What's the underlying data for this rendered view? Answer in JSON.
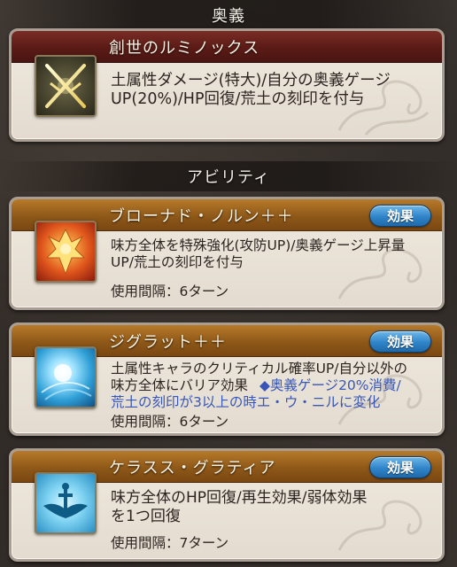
{
  "sections": {
    "ougi_label": "奥義",
    "ability_label": "アビリティ"
  },
  "ougi": {
    "name": "創世のルミノックス",
    "description_line1": "土属性ダメージ(特大)/自分の奥義ゲージ",
    "description_line2": "UP(20%)/HP回復/荒土の刻印を付与",
    "icon": "crossed-swords-icon"
  },
  "abilities": [
    {
      "name": "ブローナド・ノルン＋＋",
      "button_label": "効果",
      "description_line1": "味方全体を特殊強化(攻防UP)/奥義ゲージ上昇量",
      "description_line2": "UP/荒土の刻印を付与",
      "interval_label": "使用間隔：6ターン",
      "icon": "golden-figure-icon"
    },
    {
      "name": "ジグラット＋＋",
      "button_label": "効果",
      "description_line1": "土属性キャラのクリティカル確率UP/自分以外の",
      "description_line2_plain": "味方全体にバリア効果",
      "description_line2_highlight": "◆奥義ゲージ20%消費/",
      "description_line3": "荒土の刻印が3以上の時エ・ウ・ニルに変化",
      "interval_label": "使用間隔：6ターン",
      "icon": "light-burst-icon"
    },
    {
      "name": "ケラスス・グラティア",
      "button_label": "効果",
      "description_line1": "味方全体のHP回復/再生効果/弱体効果",
      "description_line2": "を1つ回復",
      "interval_label": "使用間隔：7ターン",
      "icon": "healing-wing-icon"
    }
  ],
  "colors": {
    "highlight_text": "#3756b8",
    "effect_button": "#2f84c8",
    "ougi_title_bar": "#5a1b16",
    "ability_title_bar": "#8e5818"
  }
}
